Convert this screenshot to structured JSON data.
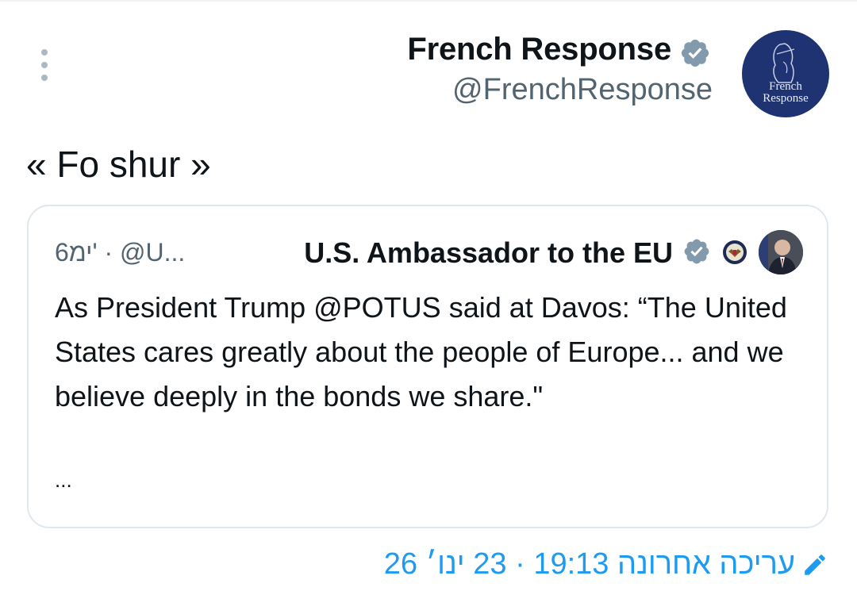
{
  "post": {
    "author_name": "French Response",
    "author_handle": "@FrenchResponse",
    "avatar_text_line1": "French",
    "avatar_text_line2": "Response",
    "text": "« Fo shur »",
    "edited_label": "עריכה אחרונה 19:13 · 23 ינו׳ 26"
  },
  "quote": {
    "author_name": "U.S. Ambassador to the EU",
    "meta": "6ימ' · @U...",
    "body": "As President Trump @POTUS said at Davos: “The United States cares greatly about the people of Europe... and we believe deeply in the bonds we share.\"",
    "ellipsis": "..."
  },
  "icons": {
    "more": "more-vertical-icon",
    "verified": "verified-badge-icon",
    "edit": "pencil-edit-icon",
    "seal": "state-department-seal-icon"
  },
  "colors": {
    "link_blue": "#1d9bf0",
    "verified_gray": "#829aab",
    "secondary_text": "#536471",
    "avatar_navy": "#1f3272"
  }
}
